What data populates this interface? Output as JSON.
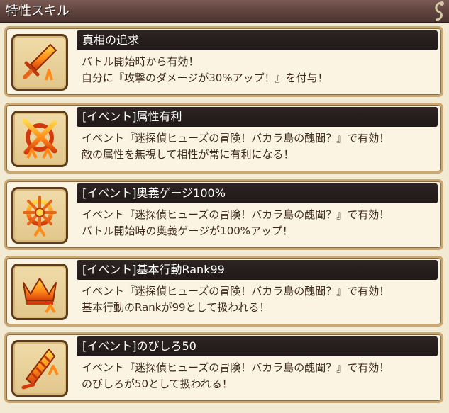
{
  "header": {
    "title": "特性スキル"
  },
  "skills": [
    {
      "icon": "sword-icon",
      "title": "真相の追求",
      "lines": [
        "バトル開始時から有効！",
        "自分に『攻撃のダメージが30%アップ！』を付与！"
      ]
    },
    {
      "icon": "attribute-advantage-icon",
      "title": "[イベント]属性有利",
      "lines": [
        "イベント『迷探偵ヒューズの冒険！バカラ島の醜聞？』で有効！",
        "敵の属性を無視して相性が常に有利になる！"
      ]
    },
    {
      "icon": "ougi-gauge-icon",
      "title": "[イベント]奥義ゲージ100%",
      "lines": [
        "イベント『迷探偵ヒューズの冒険！バカラ島の醜聞？』で有効！",
        "バトル開始時の奥義ゲージが100%アップ！"
      ]
    },
    {
      "icon": "crown-icon",
      "title": "[イベント]基本行動Rank99",
      "lines": [
        "イベント『迷探偵ヒューズの冒険！バカラ島の醜聞？』で有効！",
        "基本行動のRankが99として扱われる！"
      ]
    },
    {
      "icon": "drill-icon",
      "title": "[イベント]のびしろ50",
      "lines": [
        "イベント『迷探偵ヒューズの冒険！バカラ島の醜聞？』で有効！",
        "のびしろが50として扱われる！"
      ]
    }
  ]
}
